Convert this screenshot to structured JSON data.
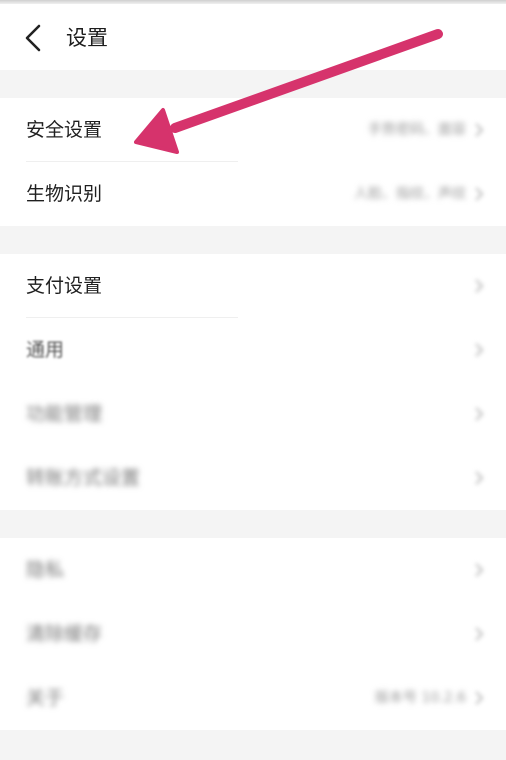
{
  "header": {
    "title": "设置",
    "back_icon": "chevron-left-icon"
  },
  "group1": {
    "items": [
      {
        "label": "安全设置",
        "value": "手势密码、面容"
      },
      {
        "label": "生物识别",
        "value": "人脸、指纹、声纹"
      }
    ]
  },
  "group2": {
    "items": [
      {
        "label": "支付设置"
      },
      {
        "label": "通用"
      },
      {
        "label": "功能管理"
      },
      {
        "label": "转账方式设置"
      }
    ]
  },
  "group3": {
    "items": [
      {
        "label": "隐私"
      },
      {
        "label": "清除缓存"
      },
      {
        "label": "关于",
        "value": "版本号 10.2.6"
      }
    ]
  },
  "annotation": {
    "arrow_color": "#d6336c",
    "arrow_icon": "pointer-arrow-icon"
  }
}
